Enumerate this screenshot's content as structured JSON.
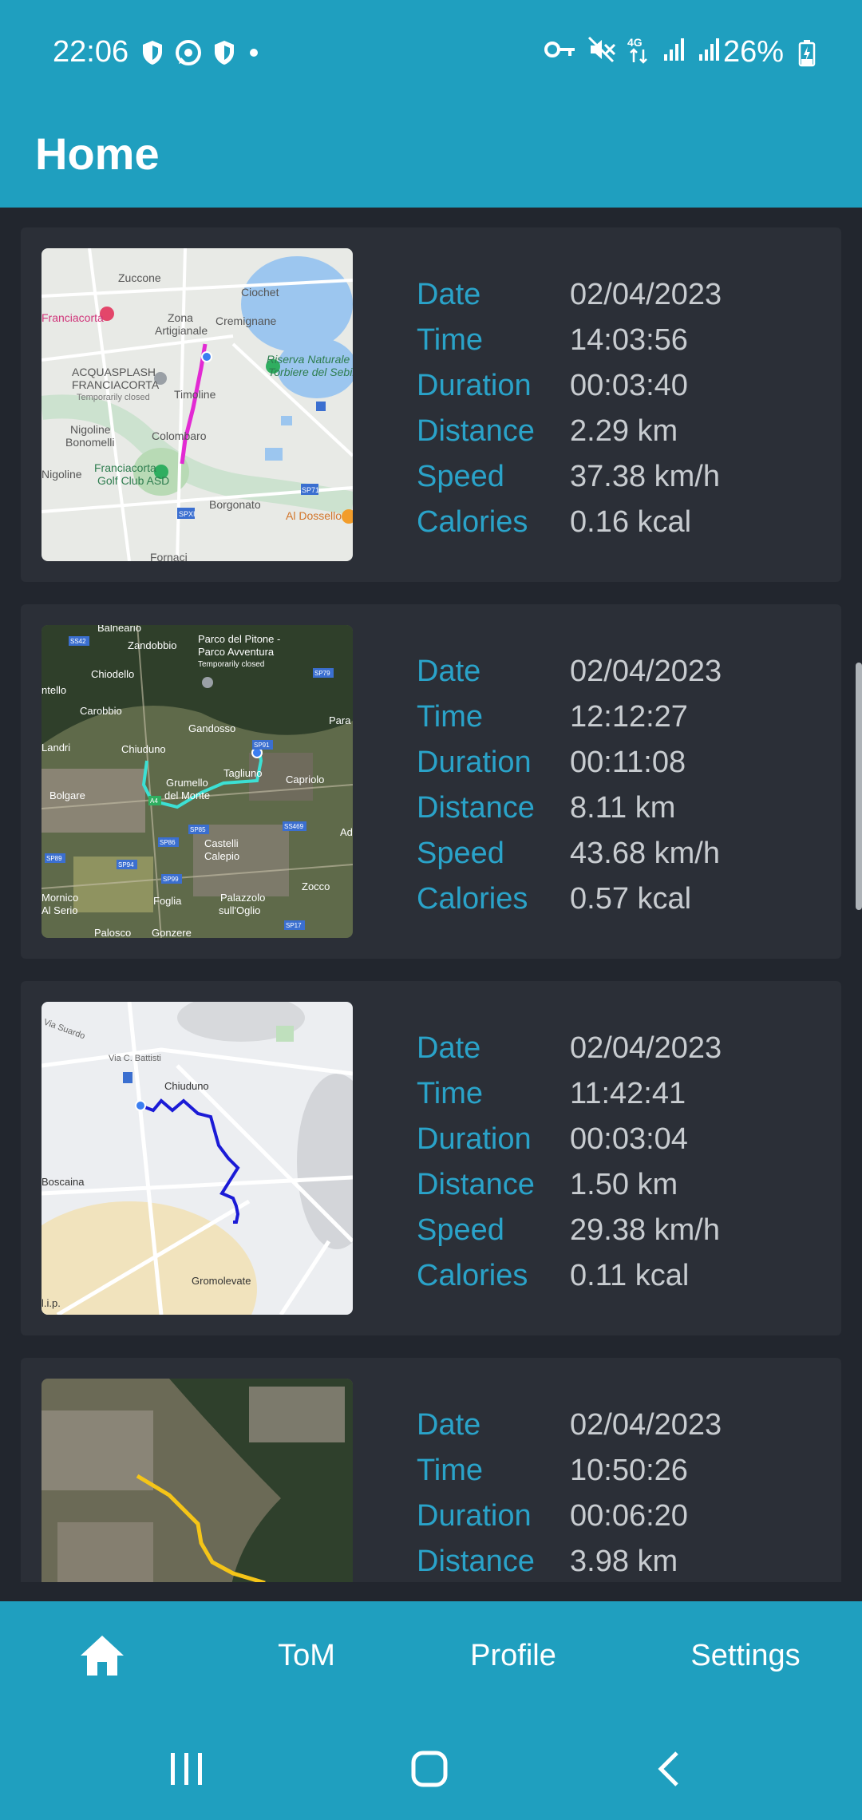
{
  "status_bar": {
    "time": "22:06",
    "battery": "26%",
    "network": "4G"
  },
  "app_bar": {
    "title": "Home"
  },
  "labels": {
    "date": "Date",
    "time": "Time",
    "duration": "Duration",
    "distance": "Distance",
    "speed": "Speed",
    "calories": "Calories"
  },
  "rides": [
    {
      "date": "02/04/2023",
      "time": "14:03:56",
      "duration": "00:03:40",
      "distance": "2.29 km",
      "speed": "37.38 km/h",
      "calories": "0.16 kcal",
      "map_style": "road",
      "route_color": "#e22ad3",
      "map_labels": [
        "Zuccone",
        "Ciochet",
        "Zona",
        "Artigianale",
        "Cremignane",
        "Franciacorta",
        "Riserva Naturale",
        "Torbiere del Sebino",
        "ACQUASPLASH",
        "FRANCIACORTA",
        "Temporarily closed",
        "Timoline",
        "Nigoline",
        "Bonomelli",
        "Colombaro",
        "Franciacorta",
        "Golf Club ASD",
        "Nigoline",
        "Borgonato",
        "Al Dossello",
        "Fornaci",
        "SPXI",
        "SP71"
      ]
    },
    {
      "date": "02/04/2023",
      "time": "12:12:27",
      "duration": "00:11:08",
      "distance": "8.11 km",
      "speed": "43.68 km/h",
      "calories": "0.57 kcal",
      "map_style": "satellite",
      "route_color": "#3ce0d4",
      "map_labels": [
        "Balneario",
        "Zandobbio",
        "Parco del Pitone -",
        "Parco Avventura",
        "Temporarily closed",
        "Chiodello",
        "ntello",
        "Carobbio",
        "Gandosso",
        "Para",
        "Landri",
        "Chiuduno",
        "Grumello",
        "del Monte",
        "Tagliuno",
        "Capriolo",
        "Bolgare",
        "Castelli",
        "Calepio",
        "Zocco",
        "Mornico",
        "Al Serio",
        "Foglia",
        "Palazzolo",
        "sull'Oglio",
        "Palosco",
        "Gonzere",
        "SS42",
        "SP79",
        "SP91",
        "SP85",
        "SP86",
        "SS469",
        "SP89",
        "SP94",
        "SP99",
        "SP17",
        "A4",
        "Ad"
      ]
    },
    {
      "date": "02/04/2023",
      "time": "11:42:41",
      "duration": "00:03:04",
      "distance": "1.50 km",
      "speed": "29.38 km/h",
      "calories": "0.11 kcal",
      "map_style": "terrain",
      "route_color": "#1b1bd6",
      "map_labels": [
        "Via Suardo",
        "Via C. Battisti",
        "Chiuduno",
        "Boscaina",
        "Gromolevate",
        "l.i.p."
      ]
    },
    {
      "date": "02/04/2023",
      "time": "10:50:26",
      "duration": "00:06:20",
      "distance": "3.98 km",
      "speed": "",
      "calories": "",
      "map_style": "satellite",
      "route_color": "#f5c518",
      "map_labels": []
    }
  ],
  "bottom_nav": {
    "items": [
      {
        "label": "",
        "icon": "home-icon"
      },
      {
        "label": "ToM"
      },
      {
        "label": "Profile"
      },
      {
        "label": "Settings"
      }
    ]
  },
  "colors": {
    "primary": "#1f9fbf",
    "background": "#22262e",
    "card": "#2b2f37",
    "label": "#2aa3c9",
    "value": "#c8ccd0"
  }
}
